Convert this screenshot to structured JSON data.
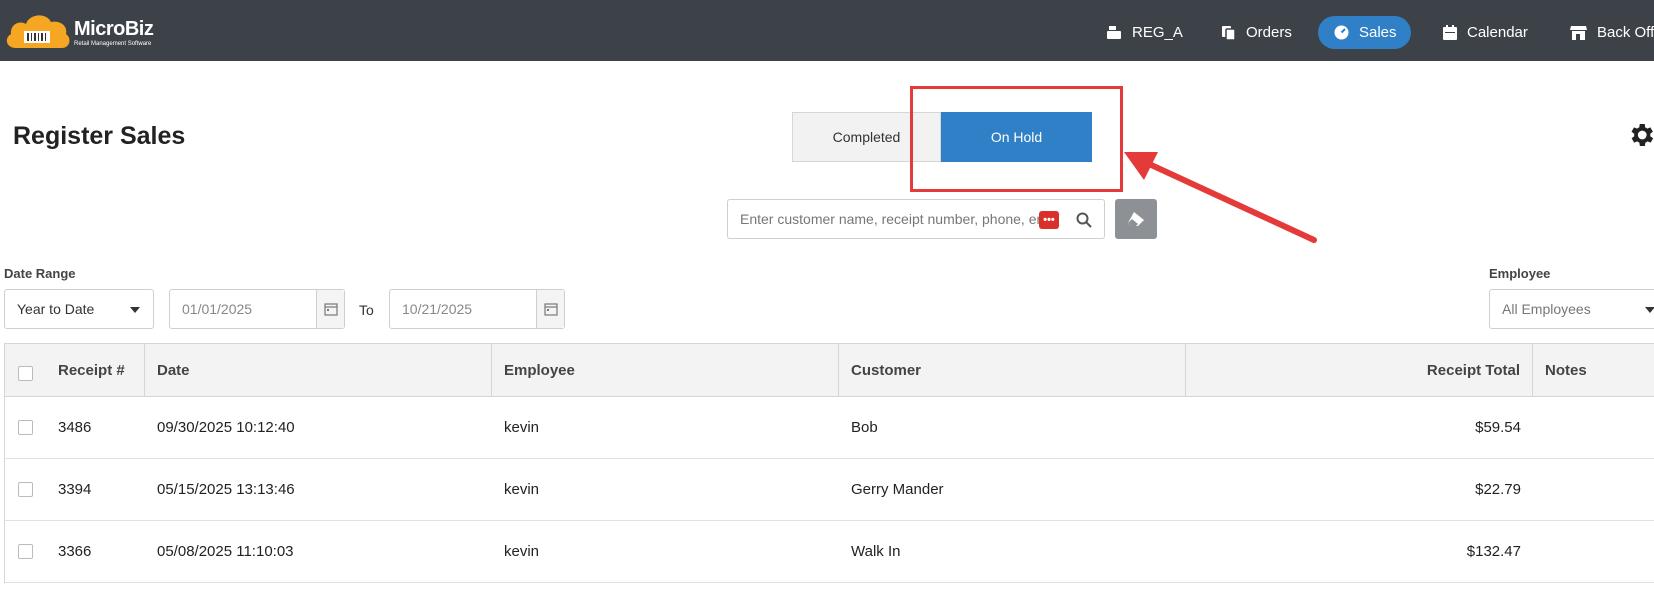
{
  "app": {
    "logo_name": "MicroBiz",
    "logo_tagline": "Retail Management Software"
  },
  "nav": {
    "register": "REG_A",
    "orders": "Orders",
    "sales": "Sales",
    "calendar": "Calendar",
    "back_office": "Back Office"
  },
  "page": {
    "title": "Register Sales"
  },
  "toggle": {
    "completed": "Completed",
    "on_hold": "On Hold",
    "active": "On Hold"
  },
  "search": {
    "placeholder": "Enter customer name, receipt number, phone, email"
  },
  "filters": {
    "date_range_label": "Date Range",
    "date_range_value": "Year to Date",
    "date_from": "01/01/2025",
    "to_label": "To",
    "date_to": "10/21/2025",
    "employee_label": "Employee",
    "employee_value": "All Employees"
  },
  "table": {
    "headers": {
      "receipt": "Receipt #",
      "date": "Date",
      "employee": "Employee",
      "customer": "Customer",
      "total": "Receipt Total",
      "notes": "Notes"
    },
    "rows": [
      {
        "receipt": "3486",
        "date": "09/30/2025 10:12:40",
        "employee": "kevin",
        "customer": "Bob",
        "total": "$59.54"
      },
      {
        "receipt": "3394",
        "date": "05/15/2025 13:13:46",
        "employee": "kevin",
        "customer": "Gerry Mander",
        "total": "$22.79"
      },
      {
        "receipt": "3366",
        "date": "05/08/2025 11:10:03",
        "employee": "kevin",
        "customer": "Walk In",
        "total": "$132.47"
      }
    ]
  },
  "colors": {
    "topbar": "#3d4248",
    "accent": "#2f80c6",
    "annotation": "#e53a3a",
    "logo_orange": "#f5a623"
  }
}
